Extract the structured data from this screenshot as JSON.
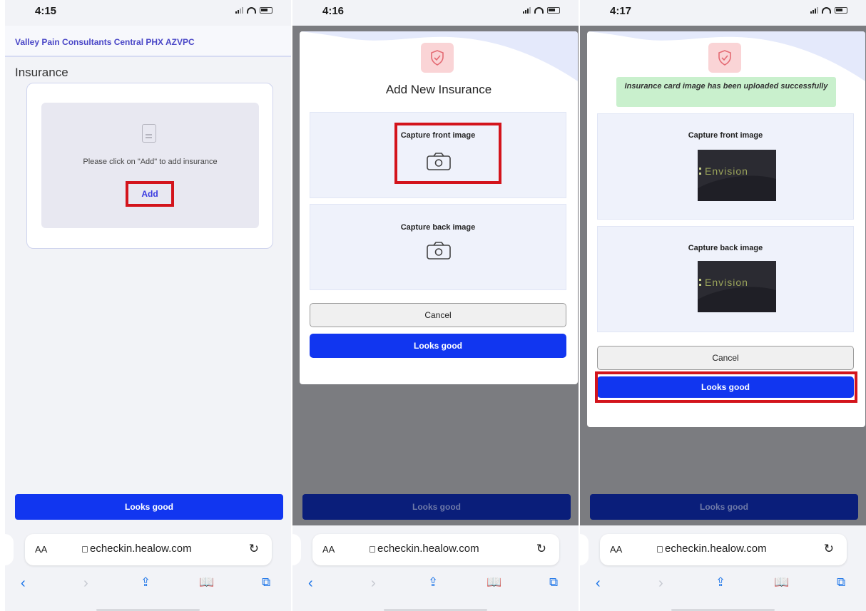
{
  "screens": [
    {
      "time": "4:15",
      "org_name": "Valley Pain Consultants Central PHX AZVPC",
      "section_title": "Insurance",
      "empty_message": "Please click on \"Add\" to add insurance",
      "add_label": "Add",
      "bottom_button": "Looks good",
      "url": "echeckin.healow.com",
      "aa": "AA"
    },
    {
      "time": "4:16",
      "modal_title": "Add New Insurance",
      "front_label": "Capture front image",
      "back_label": "Capture back image",
      "cancel_label": "Cancel",
      "looks_good_label": "Looks good",
      "bottom_button": "Looks good",
      "url": "echeckin.healow.com",
      "aa": "AA"
    },
    {
      "time": "4:17",
      "toast": "Insurance card image has been uploaded successfully",
      "front_label": "Capture front image",
      "back_label": "Capture back image",
      "card_text": "Envision",
      "cancel_label": "Cancel",
      "looks_good_label": "Looks good",
      "bottom_button": "Looks good",
      "url": "echeckin.healow.com",
      "aa": "AA"
    }
  ],
  "colors": {
    "primary": "#1136f0",
    "highlight": "#d3141c",
    "brand_text": "#4a47c7",
    "success_bg": "#c9f0cd",
    "overlay": "#7b7c80"
  },
  "icons": {
    "status": [
      "cell-signal-icon",
      "wifi-icon",
      "battery-icon"
    ],
    "toolbar": [
      "back-icon",
      "forward-icon",
      "share-icon",
      "bookmarks-icon",
      "tabs-icon"
    ],
    "shield": "shield-check-icon",
    "camera": "camera-icon"
  }
}
